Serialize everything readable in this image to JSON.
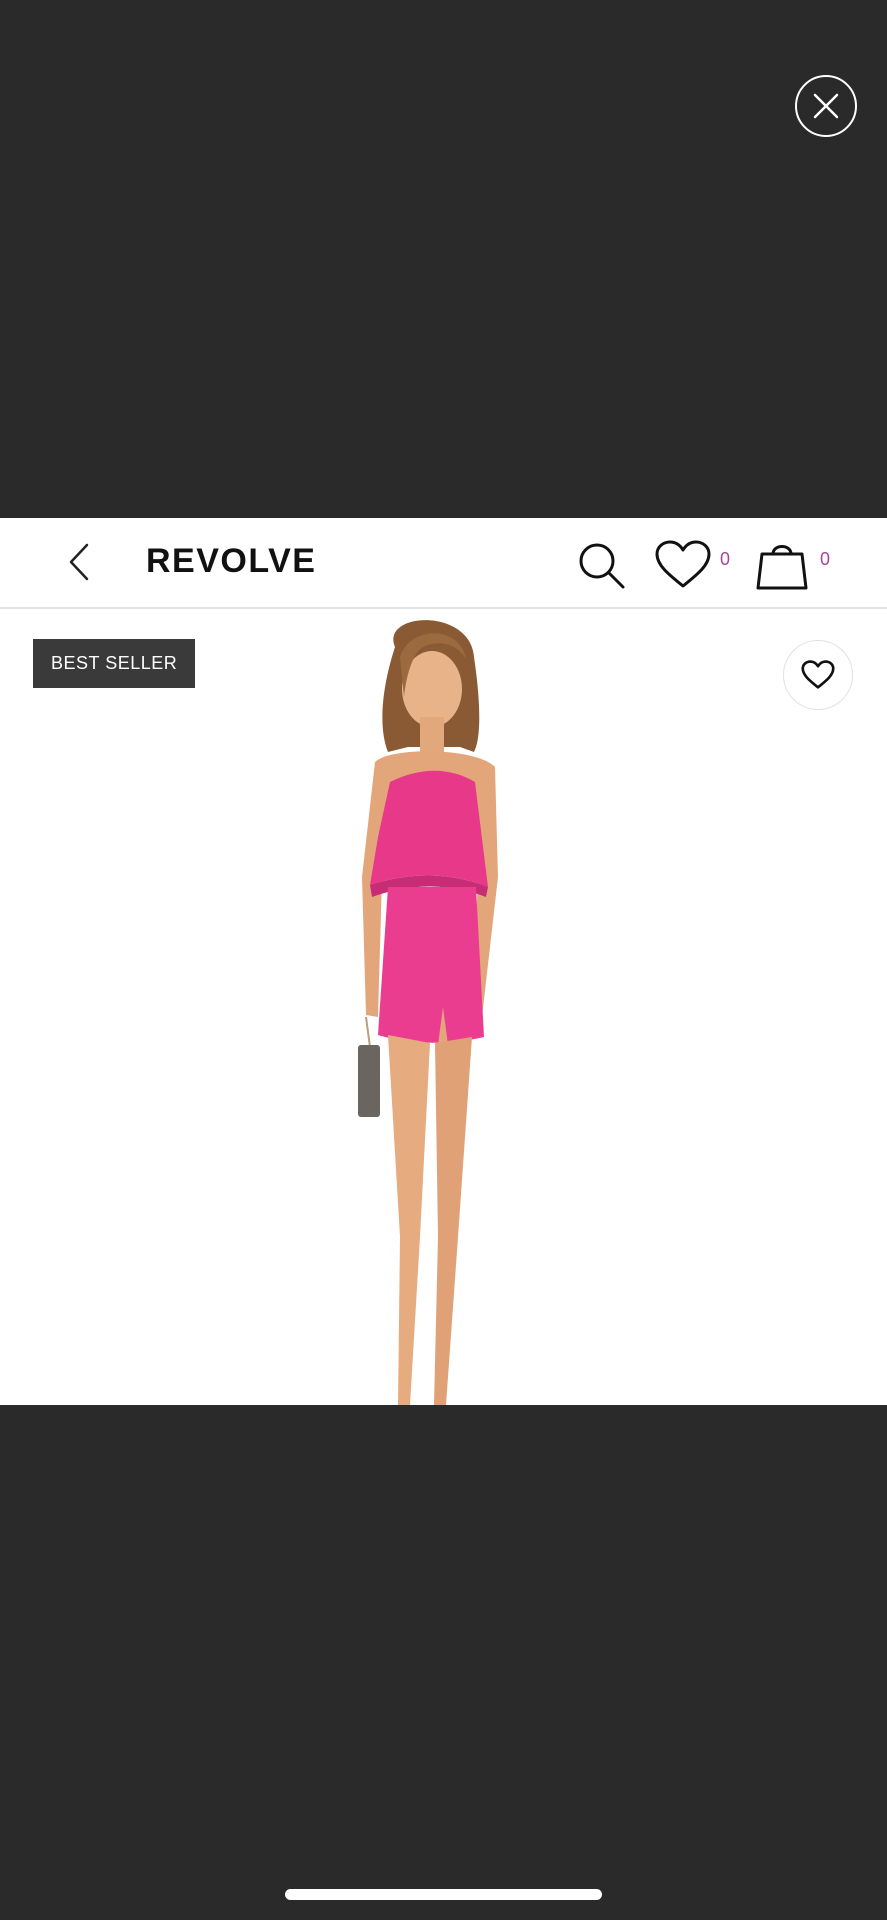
{
  "overlay": {
    "close_icon": "close-icon"
  },
  "header": {
    "logo_text": "REVOLVE",
    "back_icon": "chevron-left-icon",
    "search_icon": "search-icon",
    "wishlist_icon": "heart-icon",
    "wishlist_count": "0",
    "bag_icon": "shopping-bag-icon",
    "bag_count": "0"
  },
  "product": {
    "badge": "BEST SELLER",
    "favorite_icon": "heart-icon",
    "dress_color": "#e8388a"
  },
  "colors": {
    "background": "#2a2a2a",
    "counter_accent": "#a3479c",
    "badge_bg": "#3a3a3a"
  }
}
